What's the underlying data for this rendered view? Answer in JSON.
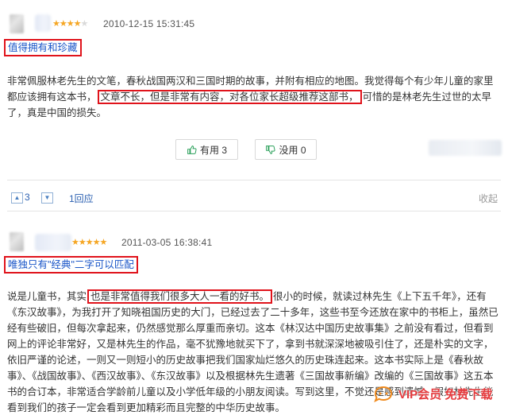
{
  "reviews": [
    {
      "rating": 4,
      "max_rating": 5,
      "date": "2010-12-15 15:31:45",
      "title": "值得拥有和珍藏",
      "body": {
        "pre": "非常佩服林老先生的文笔，春秋战国两汉和三国时期的故事，并附有相应的地图。我觉得每个有少年儿童的家里都应该拥有这本书，",
        "highlight": "文章不长，但是非常有内容，对各位家长超级推荐这部书，",
        "post": "可惜的是林老先生过世的太早了，真是中国的损失。"
      },
      "useful_label": "有用 3",
      "useless_label": "没用 0",
      "up_count": "3",
      "reply_link": "1回应",
      "fold_label": "收起"
    },
    {
      "rating": 5,
      "max_rating": 5,
      "date": "2011-03-05 16:38:41",
      "title": "唯独只有\"经典\"二字可以匹配",
      "body": {
        "pre": "说是儿童书，其实",
        "highlight": "也是非常值得我们很多大人一看的好书。",
        "post": "很小的时候，就读过林先生《上下五千年》，还有《东汉故事》，为我打开了知晓祖国历史的大门，已经过去了二十多年，这些书至今还放在家中的书柜上，虽然已经有些破旧，但每次拿起来，仍然感觉那么厚重而亲切。这本《林汉达中国历史故事集》之前没有看过，但看到网上的评论非常好，又是林先生的作品，毫不犹豫地就买下了，拿到书就深深地被吸引住了，还是朴实的文字，依旧严谨的论述，一则又一则短小的历史故事把我们国家灿烂悠久的历史珠连起来。这本书实际上是《春秋故事》、《战国故事》、《西汉故事》、《东汉故事》以及根据林先生遗著《三国故事新编》改编的《三国故事》这五本书的合订本，非常适合学龄前儿童以及小学低年级的小朋友阅读。写到这里，不觉还是感到遗憾，假如林先生能看到我们的孩子一定会看到更加精彩而且完整的中华历史故事。"
      }
    }
  ],
  "watermark": "VIP会员 免费下载",
  "colors": {
    "highlight_border": "#e0131b",
    "title_link": "#1a56c8",
    "star": "#f5a623",
    "watermark": "#e4393c"
  }
}
